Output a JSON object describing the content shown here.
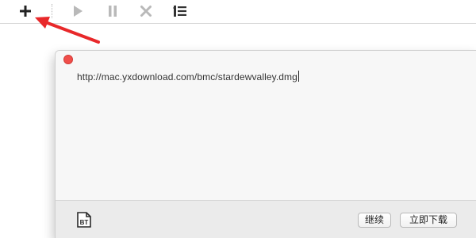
{
  "toolbar": {
    "buttons": [
      {
        "icon": "plus-icon",
        "label": "+"
      },
      {
        "icon": "play-icon"
      },
      {
        "icon": "pause-icon"
      },
      {
        "icon": "stop-icon"
      },
      {
        "icon": "list-icon"
      }
    ]
  },
  "annotation": {
    "color": "#e8282a",
    "points_to": "plus-icon"
  },
  "dialog": {
    "close_color": "#f04e4a",
    "url_value": "http://mac.yxdownload.com/bmc/stardewvalley.dmg",
    "bt_icon_label": "BT",
    "continue_label": "继续",
    "download_now_label": "立即下载"
  }
}
